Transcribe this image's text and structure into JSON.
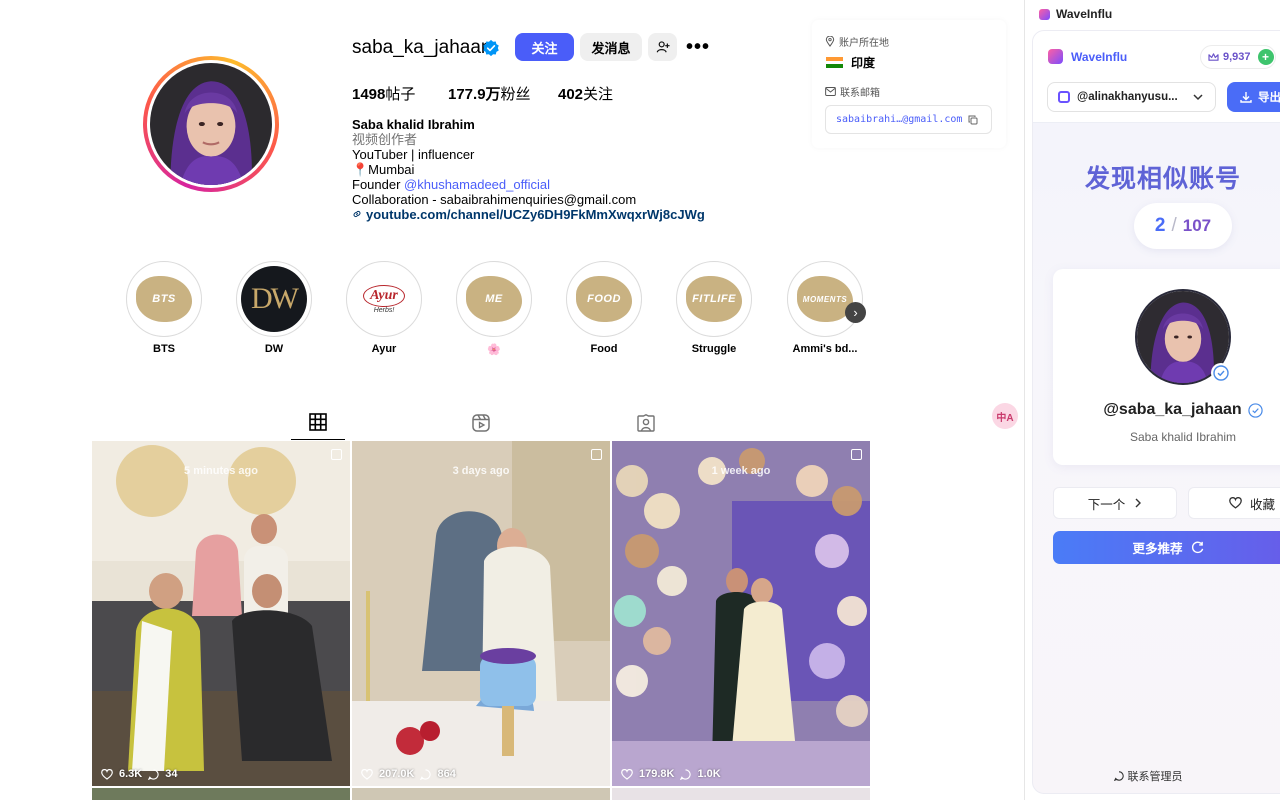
{
  "profile": {
    "username": "saba_ka_jahaan",
    "follow_label": "关注",
    "message_label": "发消息",
    "more_label": "•••",
    "stats": [
      {
        "value": "1498",
        "label": "帖子"
      },
      {
        "value": "177.9万",
        "label": "粉丝"
      },
      {
        "value": "402",
        "label": "关注"
      }
    ],
    "bio": {
      "name": "Saba khalid Ibrahim",
      "category": "视频创作者",
      "line1": "YouTuber | influencer",
      "location": "📍Mumbai",
      "founder_prefix": "Founder ",
      "founder_mention": "@khushamadeed_official",
      "collab": "Collaboration - sabaibrahimenquiries@gmail.com",
      "link": "youtube.com/channel/UCZy6DH9FkMmXwqxrWj8cJWg"
    }
  },
  "info_card": {
    "location_label": "账户所在地",
    "country": "印度",
    "email_label": "联系邮箱",
    "email": "sabaibrahi…@gmail.com"
  },
  "highlights": [
    {
      "label": "BTS",
      "text": "BTS"
    },
    {
      "label": "DW",
      "text": "DW"
    },
    {
      "label": "Ayur",
      "text": "Ayur"
    },
    {
      "label": "🌸",
      "text": "ME"
    },
    {
      "label": "Food",
      "text": "FOOD"
    },
    {
      "label": "Struggle",
      "text": "FITLIFE"
    },
    {
      "label": "Ammi's bd...",
      "text": "MOMENTS"
    }
  ],
  "highlight_extra": {
    "ayur_sub": "Herbs!"
  },
  "posts": [
    {
      "time": "5 minutes ago",
      "likes": "6.3K",
      "comments": "34"
    },
    {
      "time": "3 days ago",
      "likes": "207.0K",
      "comments": "864"
    },
    {
      "time": "1 week ago",
      "likes": "179.8K",
      "comments": "1.0K"
    }
  ],
  "translate_fab": "中A",
  "sidebar": {
    "window_title": "WaveInflu",
    "brand": "WaveInflu",
    "coins": "9,937",
    "plus": "+",
    "account": "@alinakhanyusu...",
    "export_label": "导出",
    "heading": "发现相似账号",
    "counter": {
      "current": "2",
      "sep": "/",
      "total": "107"
    },
    "card": {
      "handle": "@saba_ka_jahaan",
      "full_name": "Saba khalid Ibrahim"
    },
    "next_label": "下一个",
    "fav_label": "收藏",
    "more_label": "更多推荐",
    "admin_label": "联系管理员"
  },
  "colors": {
    "accent": "#4a5df9",
    "sidebar_heading": "#5f63d6",
    "link": "#00376b"
  }
}
